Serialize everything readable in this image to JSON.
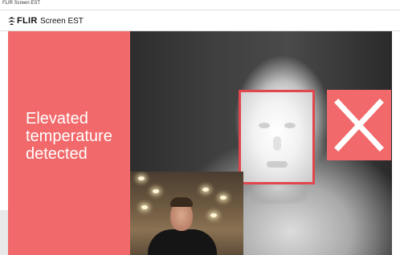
{
  "window": {
    "title": "FLIR Screen EST"
  },
  "header": {
    "logo_text": "FLIR",
    "app_name": "Screen EST"
  },
  "alert": {
    "lines": [
      "Elevated",
      "temperature",
      "detected"
    ],
    "status_icon": "x-icon",
    "colors": {
      "alert_red": "#f1696a",
      "face_box_red": "#e0474c"
    }
  },
  "views": {
    "thermal": {
      "icon": "thermal-image"
    },
    "visible_inset": {
      "icon": "visible-camera-image"
    }
  }
}
